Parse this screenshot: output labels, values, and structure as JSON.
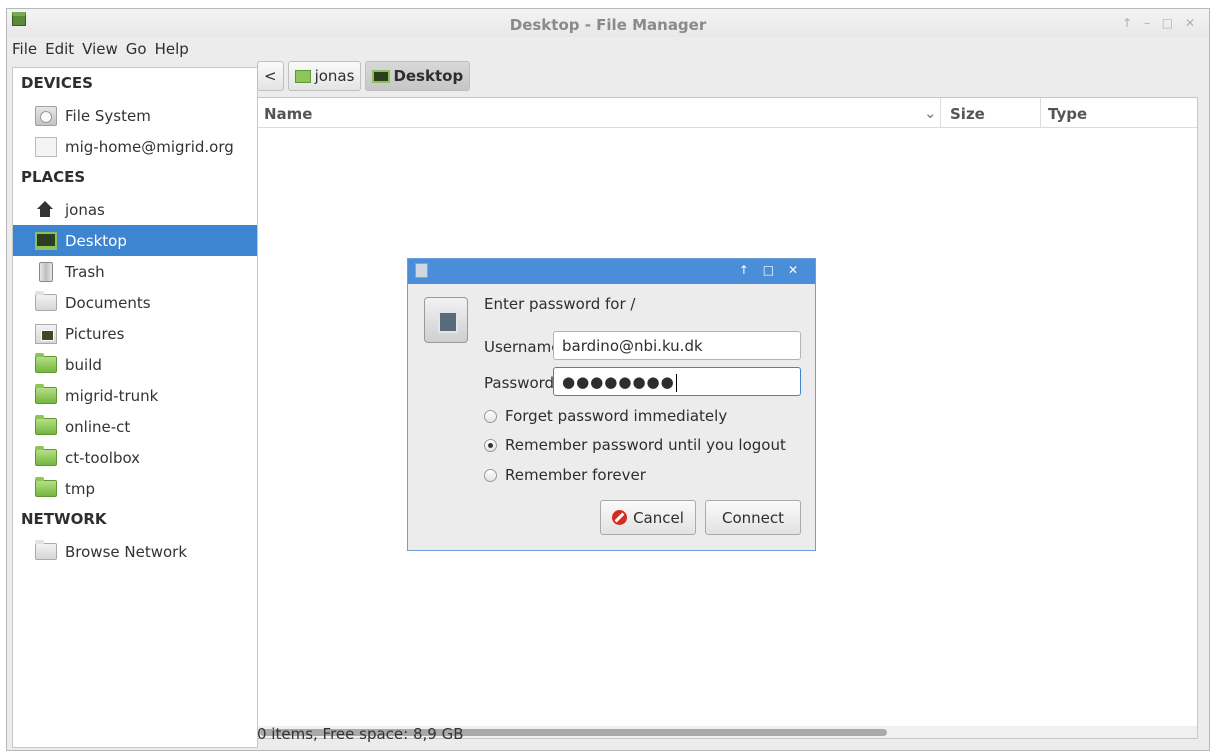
{
  "window": {
    "title": "Desktop - File Manager",
    "controls": "↑ – □ ✕"
  },
  "menu": [
    "File",
    "Edit",
    "View",
    "Go",
    "Help"
  ],
  "sidebar": {
    "devices_header": "DEVICES",
    "devices": [
      {
        "label": "File System",
        "icon": "harddrive-icon"
      },
      {
        "label": "mig-home@migrid.org",
        "icon": "network-drive-icon"
      }
    ],
    "places_header": "PLACES",
    "places": [
      {
        "label": "jonas",
        "icon": "home-icon"
      },
      {
        "label": "Desktop",
        "icon": "desktop-icon",
        "selected": true
      },
      {
        "label": "Trash",
        "icon": "trash-icon"
      },
      {
        "label": "Documents",
        "icon": "documents-folder-icon"
      },
      {
        "label": "Pictures",
        "icon": "pictures-folder-icon"
      },
      {
        "label": "build",
        "icon": "folder-icon"
      },
      {
        "label": "migrid-trunk",
        "icon": "folder-icon"
      },
      {
        "label": "online-ct",
        "icon": "folder-icon"
      },
      {
        "label": "ct-toolbox",
        "icon": "folder-icon"
      },
      {
        "label": "tmp",
        "icon": "folder-icon"
      }
    ],
    "network_header": "NETWORK",
    "network": [
      {
        "label": "Browse Network",
        "icon": "network-icon"
      }
    ]
  },
  "pathbar": {
    "back": "<",
    "crumbs": [
      "jonas",
      "Desktop"
    ]
  },
  "listview": {
    "columns": {
      "name": "Name",
      "sort_indicator": "⌄",
      "size": "Size",
      "type": "Type"
    }
  },
  "statusbar": "0 items, Free space: 8,9 GB",
  "dialog": {
    "controls": "↑ □ ✕",
    "heading": "Enter password for /",
    "username_label": "Username:",
    "username_value": "bardino@nbi.ku.dk",
    "password_label": "Password:",
    "password_value": "●●●●●●●●",
    "options": [
      {
        "label": "Forget password immediately",
        "checked": false
      },
      {
        "label": "Remember password until you logout",
        "checked": true
      },
      {
        "label": "Remember forever",
        "checked": false
      }
    ],
    "cancel_label": "Cancel",
    "connect_label": "Connect"
  }
}
